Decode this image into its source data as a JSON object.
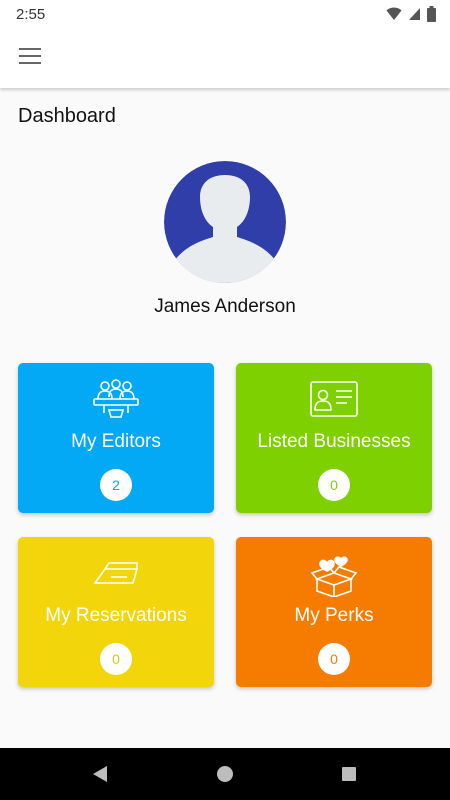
{
  "status_bar": {
    "time": "2:55",
    "icons": [
      "wifi-icon",
      "signal-icon",
      "battery-icon"
    ]
  },
  "app_bar": {
    "menu_icon": "hamburger-menu-icon"
  },
  "dashboard": {
    "title": "Dashboard",
    "user": {
      "name": "James Anderson",
      "avatar_color": "#2f3ea8"
    },
    "tiles": [
      {
        "label": "My Editors",
        "count": "2",
        "icon": "editors-icon",
        "color": "#03a9f4"
      },
      {
        "label": "Listed Businesses",
        "count": "0",
        "icon": "business-card-icon",
        "color": "#7ed000"
      },
      {
        "label": "My Reservations",
        "count": "0",
        "icon": "ticket-icon",
        "color": "#f2d50b"
      },
      {
        "label": "My Perks",
        "count": "0",
        "icon": "gift-box-icon",
        "color": "#f57c00"
      }
    ]
  },
  "nav_bar": {
    "buttons": [
      "back-icon",
      "home-icon",
      "recents-icon"
    ]
  }
}
